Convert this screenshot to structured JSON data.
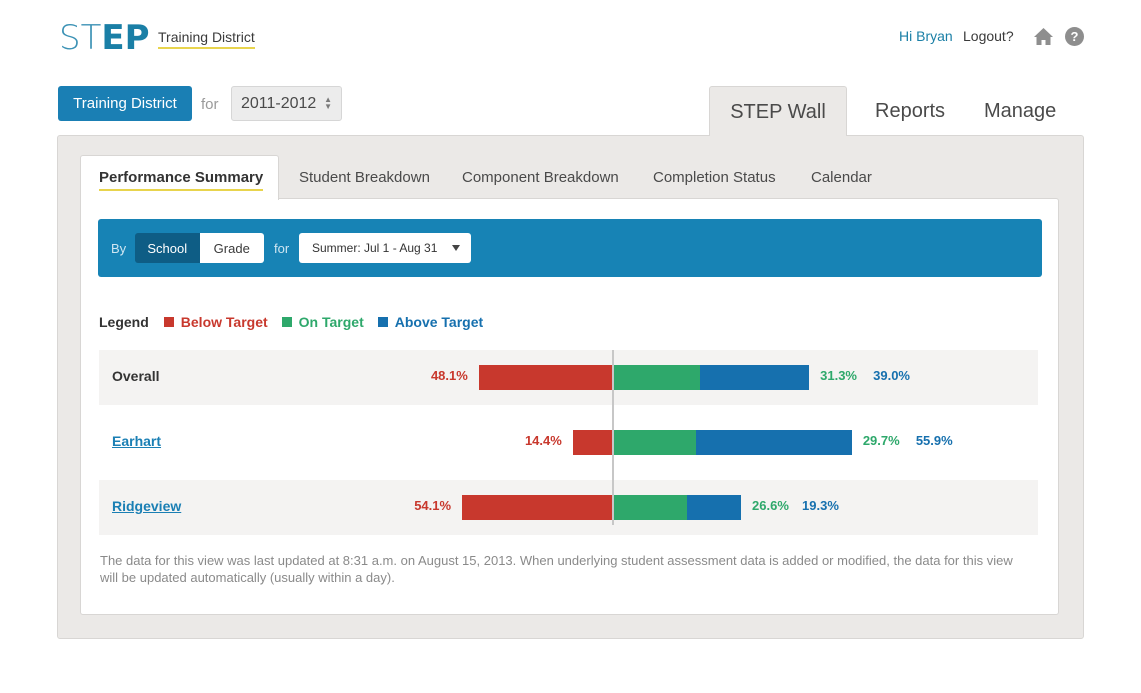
{
  "header": {
    "logo_light": "ST",
    "logo_bold": "EP",
    "district": "Training District",
    "greeting": "Hi Bryan",
    "logout": "Logout?",
    "help_glyph": "?",
    "icons": [
      "home-icon",
      "help-icon"
    ]
  },
  "context": {
    "district_button": "Training District",
    "for_label": "for",
    "year": "2011-2012"
  },
  "main_tabs": [
    {
      "label": "STEP Wall",
      "active": true
    },
    {
      "label": "Reports",
      "active": false
    },
    {
      "label": "Manage",
      "active": false
    }
  ],
  "sub_tabs": [
    {
      "label": "Performance Summary",
      "active": true
    },
    {
      "label": "Student Breakdown",
      "active": false
    },
    {
      "label": "Component Breakdown",
      "active": false
    },
    {
      "label": "Completion Status",
      "active": false
    },
    {
      "label": "Calendar",
      "active": false
    }
  ],
  "filter": {
    "by_label": "By",
    "group_options": [
      "School",
      "Grade"
    ],
    "group_selected": "School",
    "for_label": "for",
    "period": "Summer: Jul 1 - Aug 31"
  },
  "legend": {
    "title": "Legend",
    "items": [
      {
        "label": "Below Target",
        "color": "#c8382d"
      },
      {
        "label": "On Target",
        "color": "#2ea86b"
      },
      {
        "label": "Above Target",
        "color": "#1670ae"
      }
    ]
  },
  "colors": {
    "brand": "#1a7fb4",
    "below": "#c8382d",
    "on": "#2ea86b",
    "above": "#1670ae",
    "accent_underline": "#e8d44d"
  },
  "chart_data": {
    "type": "bar",
    "categories": [
      "Overall",
      "Earhart",
      "Ridgeview"
    ],
    "series": [
      {
        "name": "Below Target",
        "values": [
          48.1,
          14.4,
          54.1
        ]
      },
      {
        "name": "On Target",
        "values": [
          31.3,
          29.7,
          26.6
        ]
      },
      {
        "name": "Above Target",
        "values": [
          39.0,
          55.9,
          19.3
        ]
      }
    ],
    "value_labels": {
      "below": [
        "48.1%",
        "14.4%",
        "54.1%"
      ],
      "on": [
        "31.3%",
        "29.7%",
        "26.6%"
      ],
      "above": [
        "39.0%",
        "55.9%",
        "19.3%"
      ]
    },
    "linked_categories": [
      false,
      true,
      true
    ]
  },
  "footnote": "The data for this view was last updated at 8:31 a.m. on August 15, 2013. When underlying student assessment data is added or modified, the data for this view will be updated automatically (usually within a day)."
}
